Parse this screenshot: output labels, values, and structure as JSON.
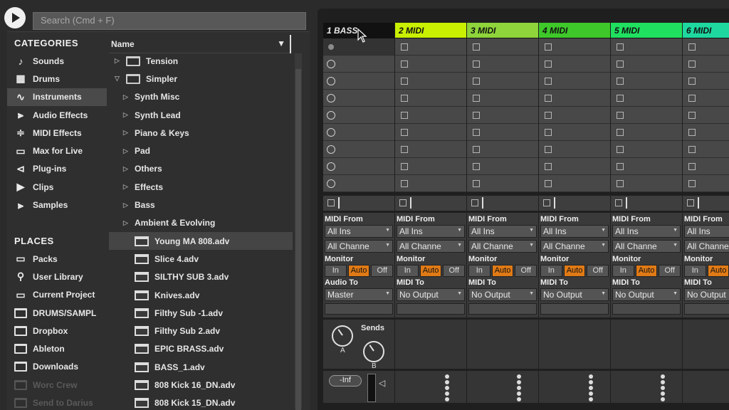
{
  "search": {
    "placeholder": "Search (Cmd + F)"
  },
  "browser": {
    "categories_title": "CATEGORIES",
    "categories": [
      {
        "label": "Sounds",
        "icon": "note-icon"
      },
      {
        "label": "Drums",
        "icon": "grid-icon"
      },
      {
        "label": "Instruments",
        "icon": "waveform-icon",
        "selected": true
      },
      {
        "label": "Audio Effects",
        "icon": "audio-fx-icon"
      },
      {
        "label": "MIDI Effects",
        "icon": "midi-fx-icon"
      },
      {
        "label": "Max for Live",
        "icon": "max-icon"
      },
      {
        "label": "Plug-ins",
        "icon": "plugin-icon"
      },
      {
        "label": "Clips",
        "icon": "clip-icon"
      },
      {
        "label": "Samples",
        "icon": "sample-icon"
      }
    ],
    "places_title": "PLACES",
    "places": [
      {
        "label": "Packs",
        "icon": "packs-icon"
      },
      {
        "label": "User Library",
        "icon": "user-icon"
      },
      {
        "label": "Current Project",
        "icon": "project-icon"
      },
      {
        "label": "DRUMS/SAMPL",
        "icon": "folder-icon"
      },
      {
        "label": "Dropbox",
        "icon": "folder-icon"
      },
      {
        "label": "Ableton",
        "icon": "folder-icon"
      },
      {
        "label": "Downloads",
        "icon": "folder-icon"
      },
      {
        "label": "Worc Crew",
        "icon": "folder-icon",
        "dim": true
      },
      {
        "label": "Send to Darius",
        "icon": "folder-icon",
        "dim": true
      }
    ],
    "column_header": "Name",
    "items": [
      {
        "label": "Tension",
        "type": "folder",
        "expanded": false
      },
      {
        "label": "Simpler",
        "type": "folder",
        "expanded": true
      },
      {
        "label": "Synth Misc",
        "type": "subfolder"
      },
      {
        "label": "Synth Lead",
        "type": "subfolder"
      },
      {
        "label": "Piano & Keys",
        "type": "subfolder"
      },
      {
        "label": "Pad",
        "type": "subfolder"
      },
      {
        "label": "Others",
        "type": "subfolder"
      },
      {
        "label": "Effects",
        "type": "subfolder"
      },
      {
        "label": "Bass",
        "type": "subfolder"
      },
      {
        "label": "Ambient & Evolving",
        "type": "subfolder"
      },
      {
        "label": "Young MA 808.adv",
        "type": "file",
        "selected": true
      },
      {
        "label": "Slice 4.adv",
        "type": "file"
      },
      {
        "label": "SILTHY SUB 3.adv",
        "type": "file"
      },
      {
        "label": "Knives.adv",
        "type": "file"
      },
      {
        "label": "Filthy Sub -1.adv",
        "type": "file"
      },
      {
        "label": "Filthy Sub  2.adv",
        "type": "file"
      },
      {
        "label": "EPIC BRASS.adv",
        "type": "file"
      },
      {
        "label": "BASS_1.adv",
        "type": "file"
      },
      {
        "label": "808 Kick 16_DN.adv",
        "type": "file"
      },
      {
        "label": "808 Kick 15_DN.adv",
        "type": "file"
      }
    ]
  },
  "tracks": [
    {
      "name": "1 BASS",
      "color": "#111111",
      "text_color": "#e8e8e8",
      "type": "audio",
      "source_label": "",
      "source": "",
      "channel": "",
      "monitor_label": "",
      "route_label": "Audio To",
      "route": "Master"
    },
    {
      "name": "2 MIDI",
      "color": "#c8f000",
      "text_color": "#111111",
      "type": "midi",
      "source_label": "MIDI From",
      "source": "All Ins",
      "channel": "All Channe",
      "monitor_label": "Monitor",
      "route_label": "MIDI To",
      "route": "No Output"
    },
    {
      "name": "3 MIDI",
      "color": "#8ed43a",
      "text_color": "#111111",
      "type": "midi",
      "source_label": "MIDI From",
      "source": "All Ins",
      "channel": "All Channe",
      "monitor_label": "Monitor",
      "route_label": "MIDI To",
      "route": "No Output"
    },
    {
      "name": "4 MIDI",
      "color": "#3ec82a",
      "text_color": "#111111",
      "type": "midi",
      "source_label": "MIDI From",
      "source": "All Ins",
      "channel": "All Channe",
      "monitor_label": "Monitor",
      "route_label": "MIDI To",
      "route": "No Output"
    },
    {
      "name": "5 MIDI",
      "color": "#20e060",
      "text_color": "#111111",
      "type": "midi",
      "source_label": "MIDI From",
      "source": "All Ins",
      "channel": "All Channe",
      "monitor_label": "Monitor",
      "route_label": "MIDI To",
      "route": "No Output"
    },
    {
      "name": "6 MIDI",
      "color": "#1ed8a0",
      "text_color": "#111111",
      "type": "midi",
      "source_label": "MIDI From",
      "source": "All Ins",
      "channel": "All Channe",
      "monitor_label": "Monitor",
      "route_label": "MIDI To",
      "route": "No Output"
    }
  ],
  "bass_track": {
    "source_label": "MIDI From",
    "source": "All Ins",
    "channel": "All Channe",
    "monitor_label": "Monitor"
  },
  "monitor": {
    "in": "In",
    "auto": "Auto",
    "off": "Off"
  },
  "sends": {
    "label": "Sends",
    "a": "A",
    "b": "B"
  },
  "mixer": {
    "volume": "-Inf"
  },
  "colors": {
    "accent": "#e07a16",
    "panel": "#2f2f2f",
    "session_bg": "#1f1f1f"
  }
}
